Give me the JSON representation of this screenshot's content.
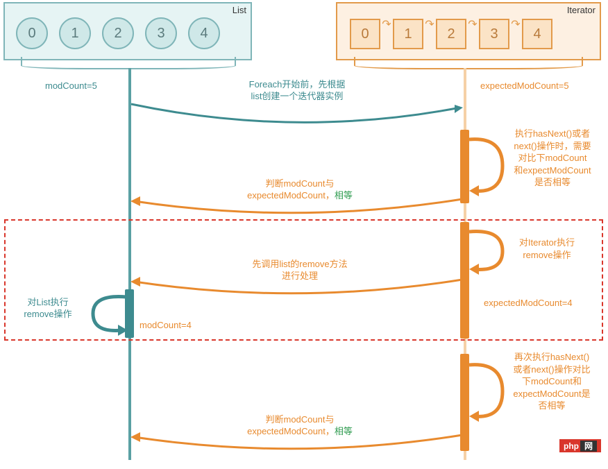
{
  "listBox": {
    "title": "List",
    "items": [
      "0",
      "1",
      "2",
      "3",
      "4"
    ]
  },
  "iterBox": {
    "title": "Iterator",
    "items": [
      "0",
      "1",
      "2",
      "3",
      "4"
    ]
  },
  "labels": {
    "modCount5": "modCount=5",
    "expectedModCount5": "expectedModCount=5",
    "foreachText": "Foreach开始前，先根据\nlist创建一个迭代器实例",
    "noteHasNext": "执行hasNext()或者\nnext()操作时，需要\n对比下modCount\n和expectModCount\n是否相等",
    "judge1_a": "判断modCount与",
    "judge1_b": "expectedModCount，",
    "equal": "相等",
    "noteIterRemove": "对Iterator执行\nremove操作",
    "callRemove_a": "先调用list的remove方法",
    "callRemove_b": "进行处理",
    "expectedModCount4": "expectedModCount=4",
    "listRemove": "对List执行\nremove操作",
    "modCount4": "modCount=4",
    "noteHasNext2": "再次执行hasNext()\n或者next()操作对比\n下modCount和\nexpectModCount是\n否相等",
    "judge2_a": "判断modCount与",
    "judge2_b": "expectedModCount，",
    "php": "php",
    "phpSuffix": "网"
  }
}
